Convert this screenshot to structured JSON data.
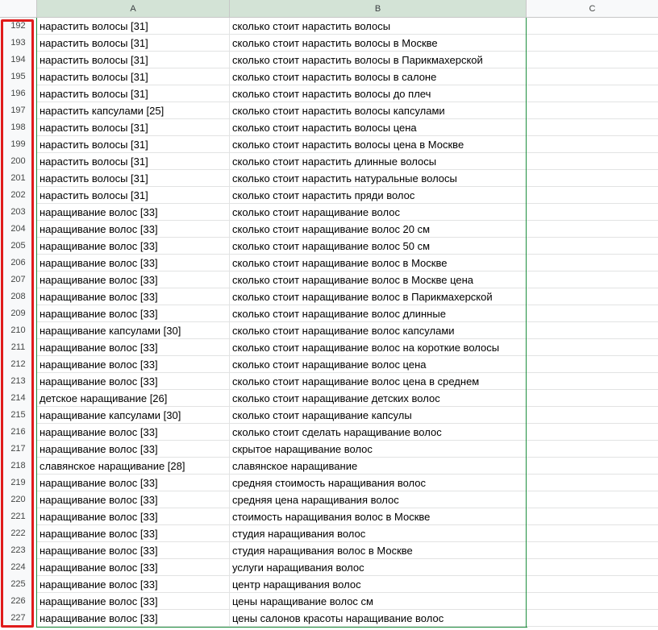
{
  "columns": [
    "A",
    "B",
    "C"
  ],
  "rows": [
    {
      "n": "192",
      "a": "нарастить волосы [31]",
      "b": "сколько стоит нарастить волосы"
    },
    {
      "n": "193",
      "a": "нарастить волосы [31]",
      "b": "сколько стоит нарастить волосы в Москве"
    },
    {
      "n": "194",
      "a": "нарастить волосы [31]",
      "b": "сколько стоит нарастить волосы в Парикмахерской"
    },
    {
      "n": "195",
      "a": "нарастить волосы [31]",
      "b": "сколько стоит нарастить волосы в салоне"
    },
    {
      "n": "196",
      "a": "нарастить волосы [31]",
      "b": "сколько стоит нарастить волосы до плеч"
    },
    {
      "n": "197",
      "a": "нарастить капсулами [25]",
      "b": "сколько стоит нарастить волосы капсулами"
    },
    {
      "n": "198",
      "a": "нарастить волосы [31]",
      "b": "сколько стоит нарастить волосы цена"
    },
    {
      "n": "199",
      "a": "нарастить волосы [31]",
      "b": "сколько стоит нарастить волосы цена в Москве"
    },
    {
      "n": "200",
      "a": "нарастить волосы [31]",
      "b": "сколько стоит нарастить длинные волосы"
    },
    {
      "n": "201",
      "a": "нарастить волосы [31]",
      "b": "сколько стоит нарастить натуральные волосы"
    },
    {
      "n": "202",
      "a": "нарастить волосы [31]",
      "b": "сколько стоит нарастить пряди волос"
    },
    {
      "n": "203",
      "a": "наращивание волос [33]",
      "b": "сколько стоит наращивание волос"
    },
    {
      "n": "204",
      "a": "наращивание волос [33]",
      "b": "сколько стоит наращивание волос 20 см"
    },
    {
      "n": "205",
      "a": "наращивание волос [33]",
      "b": "сколько стоит наращивание волос 50 см"
    },
    {
      "n": "206",
      "a": "наращивание волос [33]",
      "b": "сколько стоит наращивание волос в Москве"
    },
    {
      "n": "207",
      "a": "наращивание волос [33]",
      "b": "сколько стоит наращивание волос в Москве цена"
    },
    {
      "n": "208",
      "a": "наращивание волос [33]",
      "b": "сколько стоит наращивание волос в Парикмахерской"
    },
    {
      "n": "209",
      "a": "наращивание волос [33]",
      "b": "сколько стоит наращивание волос длинные"
    },
    {
      "n": "210",
      "a": "наращивание капсулами [30]",
      "b": "сколько стоит наращивание волос капсулами"
    },
    {
      "n": "211",
      "a": "наращивание волос [33]",
      "b": "сколько стоит наращивание волос на короткие волосы"
    },
    {
      "n": "212",
      "a": "наращивание волос [33]",
      "b": "сколько стоит наращивание волос цена"
    },
    {
      "n": "213",
      "a": "наращивание волос [33]",
      "b": "сколько стоит наращивание волос цена в среднем"
    },
    {
      "n": "214",
      "a": "детское наращивание [26]",
      "b": "сколько стоит наращивание детских волос"
    },
    {
      "n": "215",
      "a": "наращивание капсулами [30]",
      "b": "сколько стоит наращивание капсулы"
    },
    {
      "n": "216",
      "a": "наращивание волос [33]",
      "b": "сколько стоит сделать наращивание волос"
    },
    {
      "n": "217",
      "a": "наращивание волос [33]",
      "b": "скрытое наращивание волос"
    },
    {
      "n": "218",
      "a": "славянское наращивание [28]",
      "b": "славянское наращивание"
    },
    {
      "n": "219",
      "a": "наращивание волос [33]",
      "b": "средняя стоимость наращивания волос"
    },
    {
      "n": "220",
      "a": "наращивание волос [33]",
      "b": "средняя цена наращивания волос"
    },
    {
      "n": "221",
      "a": "наращивание волос [33]",
      "b": "стоимость наращивания волос в Москве"
    },
    {
      "n": "222",
      "a": "наращивание волос [33]",
      "b": "студия наращивания волос"
    },
    {
      "n": "223",
      "a": "наращивание волос [33]",
      "b": "студия наращивания волос в Москве"
    },
    {
      "n": "224",
      "a": "наращивание волос [33]",
      "b": "услуги наращивания волос"
    },
    {
      "n": "225",
      "a": "наращивание волос [33]",
      "b": "центр наращивания волос"
    },
    {
      "n": "226",
      "a": "наращивание волос [33]",
      "b": "цены наращивание волос см"
    },
    {
      "n": "227",
      "a": "наращивание волос [33]",
      "b": "цены салонов красоты наращивание волос"
    }
  ],
  "colors": {
    "highlight_box": "#e01b1b",
    "selected_header": "#d3e3d6",
    "selection_border": "#1e8e3e"
  }
}
